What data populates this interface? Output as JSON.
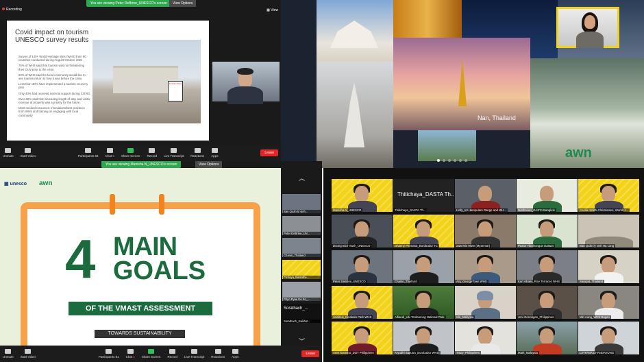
{
  "q1": {
    "recording": "Recording",
    "banner": "You are viewing Peter DeBrine_UNESCO's screen",
    "view_options": "View Options",
    "view_label": "View",
    "slide_title": "Covid impact on tourism UNESCO survey results",
    "slide_intro": "Survey of 140+ World Heritage sites (WHS) from 60 countries conducted during August-October 2021",
    "bullets": [
      "75% of WHS said that tourism was not threatening their OUV prior to the crisis",
      "84% of WHS said the local community would like to see tourism return to how it was before the crisis.",
      "Less than 40% have implemented a tourism recovery plan",
      "Only 40% had received external support during COVID",
      "Over 60% said that increasing length of stay and visitor revenue at property was a priority for the future.",
      "Most needed resources: innovations/best practices from WHS and training on engaging with local community"
    ],
    "sign_text": "Important Notice",
    "toolbar": [
      "Unmute",
      "Start Video",
      "Participants",
      "Chat",
      "Share Screen",
      "Record",
      "Live Transcript",
      "Reactions",
      "Apps"
    ],
    "participants_count": "84",
    "chat_badge": "5",
    "leave": "Leave"
  },
  "q2": {
    "caption": "Nan, Thailand",
    "logo": "awn"
  },
  "q3": {
    "banner": "You are viewing Manisha.N_UNESCO's screen",
    "view_options": "View Options",
    "unesco_logo": "unesco",
    "awn_logo": "awn",
    "four": "4",
    "main": "MAIN",
    "goals": "GOALS",
    "subtitle": "OF THE VMAST ASSESSMENT",
    "towards": "TOWARDS SUSTAINABILITY",
    "side_names": [
      "Ban Quản lý vịnh...",
      "Peter DeBrine_UN...",
      "Chanin_Thailand",
      "Pichaya_Batsothe...",
      "Phyo Pyae Ko Ko_...",
      "Sorathach_...",
      "Sorathach_Saikhot..."
    ],
    "toolbar": [
      "Unmute",
      "Start Video",
      "Participants",
      "Chat",
      "Share Screen",
      "Record",
      "Live Transcript",
      "Reactions",
      "Apps"
    ],
    "participants_count": "81",
    "chat_badge": "1",
    "leave": "Leave"
  },
  "q4": {
    "tiles": [
      [
        "Manisha.N_UNESCO",
        "Thitichaya_DASTA Th...",
        "Holly_Int Hampulam Range and WH...",
        "Natthanan_DASTA Bangkok",
        "Cecilie Smith-Christensen, World H..."
      ],
      [
        "Duong Bich Hanh_UNESCO",
        "Dhanny Permana_Borobudur TC",
        "Zaw Min Htwe (Myanmar)",
        "Pasan Yibulnongun Dasta4",
        "Ban Quản lý vịnh Hạ Long"
      ],
      [
        "Peter DeBrine_UNESCO",
        "Chanin_Thailand",
        "Arq_GeorgeTown WHS",
        "Karl Albalis_Rice Terraces WHS",
        "Sarapat_Thailand"
      ],
      [
        "Jostinus_Kinabalu Park-WHS",
        "Alfiandi_Ulu Temburong National Park",
        "Ida_Malaysia",
        "Jeni Gonongan_Philippines",
        "Min Aung_WHS Bagan"
      ],
      [
        "Aren Somono_DOT Philippines",
        "Aryudhi Saputra_Borobudur WHS",
        "Tracy_Philippines",
        "Mark_Malaysia",
        "LATTANA CHANDAVONG"
      ]
    ]
  }
}
